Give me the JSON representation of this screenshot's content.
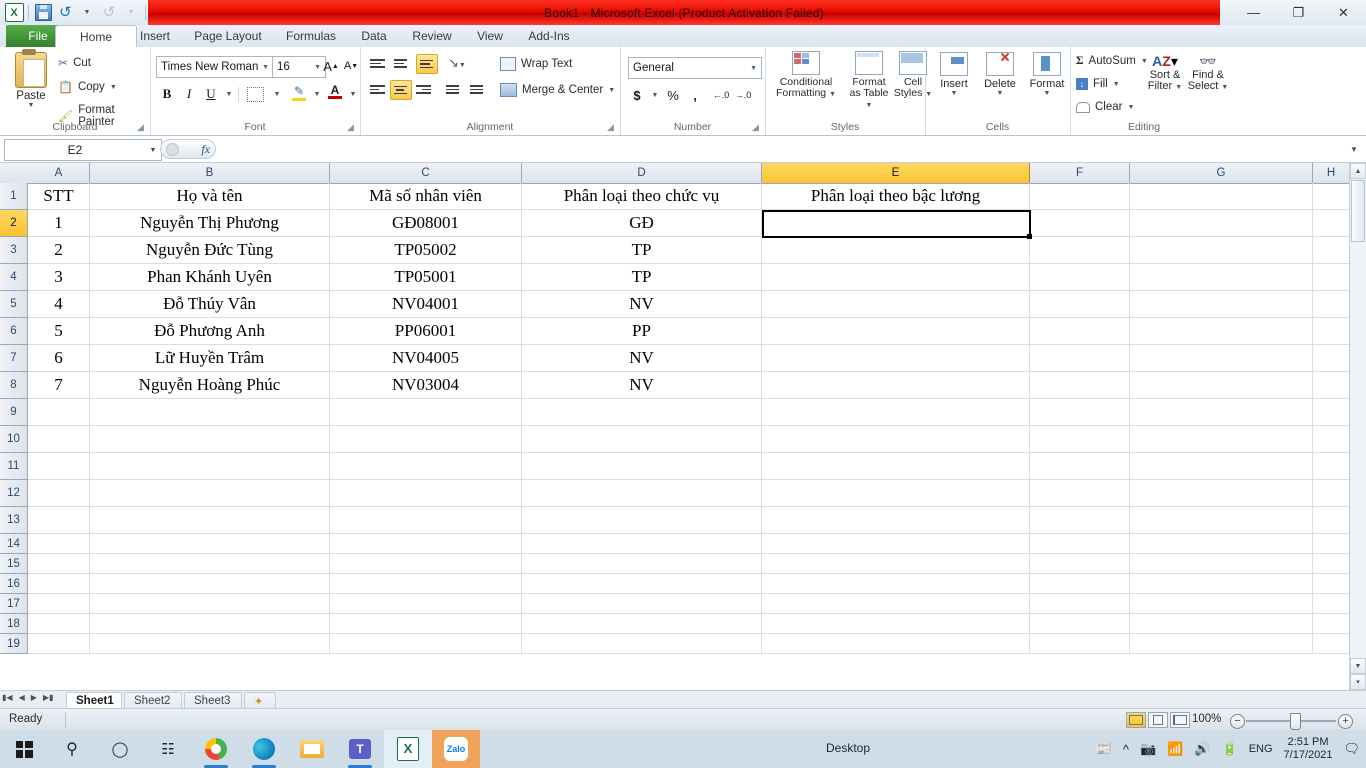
{
  "window": {
    "title": "Book1  -  Microsoft Excel (Product Activation Failed)",
    "qat": {
      "excel_logo": "excel-logo",
      "save": "save-icon",
      "undo": "undo-icon",
      "redo": "redo-icon",
      "customize": "customize-qat-icon"
    },
    "controls": {
      "minimize": "—",
      "restore": "❐",
      "close": "✕"
    },
    "help_controls": {
      "minimize_ribbon": "⌃",
      "help": "?",
      "min": "–",
      "restore": "❐",
      "close": "✖"
    }
  },
  "ribbon": {
    "tabs": [
      {
        "label": "File",
        "active": false,
        "file": true
      },
      {
        "label": "Home",
        "active": true
      },
      {
        "label": "Insert",
        "active": false
      },
      {
        "label": "Page Layout",
        "active": false
      },
      {
        "label": "Formulas",
        "active": false
      },
      {
        "label": "Data",
        "active": false
      },
      {
        "label": "Review",
        "active": false
      },
      {
        "label": "View",
        "active": false
      },
      {
        "label": "Add-Ins",
        "active": false
      }
    ],
    "clipboard": {
      "label": "Clipboard",
      "paste": "Paste",
      "cut": "Cut",
      "copy": "Copy",
      "format_painter": "Format Painter"
    },
    "font": {
      "label": "Font",
      "font_name": "Times New Roman",
      "font_size": "16",
      "grow": "A",
      "shrink": "A",
      "bold": "B",
      "italic": "I",
      "underline": "U",
      "borders": "borders-icon",
      "fill_color": "fill-color-icon",
      "font_color": "font-color-icon"
    },
    "alignment": {
      "label": "Alignment",
      "wrap_text": "Wrap Text",
      "merge_center": "Merge & Center",
      "orientation": "orientation-icon",
      "indent_decrease": "decrease-indent-icon",
      "indent_increase": "increase-indent-icon"
    },
    "number": {
      "label": "Number",
      "format": "General",
      "accounting": "$",
      "percent": "%",
      "comma": ",",
      "increase_decimal": "increase-decimal-icon",
      "decrease_decimal": "decrease-decimal-icon"
    },
    "styles": {
      "label": "Styles",
      "conditional_formatting": "Conditional\nFormatting",
      "conditional_formatting_l1": "Conditional",
      "conditional_formatting_l2": "Formatting",
      "format_as_table_l1": "Format",
      "format_as_table_l2": "as Table",
      "cell_styles_l1": "Cell",
      "cell_styles_l2": "Styles"
    },
    "cells": {
      "label": "Cells",
      "insert": "Insert",
      "delete": "Delete",
      "format": "Format"
    },
    "editing": {
      "label": "Editing",
      "autosum": "AutoSum",
      "fill": "Fill",
      "clear": "Clear",
      "sort_filter_l1": "Sort &",
      "sort_filter_l2": "Filter",
      "find_select_l1": "Find &",
      "find_select_l2": "Select"
    }
  },
  "formula_bar": {
    "name_box": "E2",
    "formula_value": "",
    "fx_label": "fx"
  },
  "grid": {
    "columns": [
      "A",
      "B",
      "C",
      "D",
      "E",
      "F",
      "G",
      "H"
    ],
    "selected_column": "E",
    "selected_row": 2,
    "selected_cell": "E2",
    "rows": [
      {
        "n": 1,
        "cells": [
          "STT",
          "Họ và tên",
          "Mã số nhân viên",
          "Phân loại theo chức vụ",
          "Phân loại theo bậc lương",
          "",
          "",
          ""
        ]
      },
      {
        "n": 2,
        "cells": [
          "1",
          "Nguyễn Thị Phương",
          "GĐ08001",
          "GĐ",
          "",
          "",
          "",
          ""
        ]
      },
      {
        "n": 3,
        "cells": [
          "2",
          "Nguyễn Đức Tùng",
          "TP05002",
          "TP",
          "",
          "",
          "",
          ""
        ]
      },
      {
        "n": 4,
        "cells": [
          "3",
          "Phan Khánh Uyên",
          "TP05001",
          "TP",
          "",
          "",
          "",
          ""
        ]
      },
      {
        "n": 5,
        "cells": [
          "4",
          "Đỗ Thúy Vân",
          "NV04001",
          "NV",
          "",
          "",
          "",
          ""
        ]
      },
      {
        "n": 6,
        "cells": [
          "5",
          "Đỗ Phương Anh",
          "PP06001",
          "PP",
          "",
          "",
          "",
          ""
        ]
      },
      {
        "n": 7,
        "cells": [
          "6",
          "Lữ Huyền Trâm",
          "NV04005",
          "NV",
          "",
          "",
          "",
          ""
        ]
      },
      {
        "n": 8,
        "cells": [
          "7",
          "Nguyễn Hoàng Phúc",
          "NV03004",
          "NV",
          "",
          "",
          "",
          ""
        ]
      },
      {
        "n": 9,
        "cells": [
          "",
          "",
          "",
          "",
          "",
          "",
          "",
          ""
        ]
      },
      {
        "n": 10,
        "cells": [
          "",
          "",
          "",
          "",
          "",
          "",
          "",
          ""
        ]
      },
      {
        "n": 11,
        "cells": [
          "",
          "",
          "",
          "",
          "",
          "",
          "",
          ""
        ]
      },
      {
        "n": 12,
        "cells": [
          "",
          "",
          "",
          "",
          "",
          "",
          "",
          ""
        ]
      },
      {
        "n": 13,
        "cells": [
          "",
          "",
          "",
          "",
          "",
          "",
          "",
          ""
        ]
      },
      {
        "n": 14,
        "cells": [
          "",
          "",
          "",
          "",
          "",
          "",
          "",
          ""
        ]
      },
      {
        "n": 15,
        "cells": [
          "",
          "",
          "",
          "",
          "",
          "",
          "",
          ""
        ]
      },
      {
        "n": 16,
        "cells": [
          "",
          "",
          "",
          "",
          "",
          "",
          "",
          ""
        ]
      },
      {
        "n": 17,
        "cells": [
          "",
          "",
          "",
          "",
          "",
          "",
          "",
          ""
        ]
      },
      {
        "n": 18,
        "cells": [
          "",
          "",
          "",
          "",
          "",
          "",
          "",
          ""
        ]
      },
      {
        "n": 19,
        "cells": [
          "",
          "",
          "",
          "",
          "",
          "",
          "",
          ""
        ]
      }
    ]
  },
  "sheet_tabs": {
    "tabs": [
      "Sheet1",
      "Sheet2",
      "Sheet3"
    ],
    "active": "Sheet1",
    "insert_sheet": "insert-sheet-icon",
    "nav": {
      "first": "⏮",
      "prev": "◀",
      "next": "▶",
      "last": "⏭"
    }
  },
  "status_bar": {
    "state": "Ready",
    "zoom": "100%",
    "view_normal": "normal-view-icon",
    "view_page_layout": "page-layout-view-icon",
    "view_page_break": "page-break-view-icon",
    "zoom_out": "−",
    "zoom_in": "+"
  },
  "taskbar": {
    "start": "start-icon",
    "search": "search-icon",
    "cortana": "cortana-icon",
    "task_view": "task-view-icon",
    "apps": [
      {
        "name": "app-chrome-like",
        "label": ""
      },
      {
        "name": "app-edge",
        "label": ""
      },
      {
        "name": "app-file-explorer",
        "label": ""
      },
      {
        "name": "app-teams",
        "label": ""
      },
      {
        "name": "app-excel",
        "label": ""
      },
      {
        "name": "app-zalo",
        "label": "Zalo"
      }
    ],
    "desktop_label": "Desktop",
    "tray": {
      "news": "news-and-interests-icon",
      "show_hidden": "show-hidden-icons-icon",
      "meet_now": "meet-now-icon",
      "network": "network-icon",
      "volume": "volume-icon",
      "battery": "battery-icon",
      "language": "ENG",
      "time": "2:51 PM",
      "date": "7/17/2021",
      "action_center": "action-center-icon"
    }
  },
  "colors": {
    "title_red": "#e60d00",
    "file_green": "#3f8f33",
    "selection_yellow": "#f8c330",
    "header_blue": "#2b4a72"
  }
}
